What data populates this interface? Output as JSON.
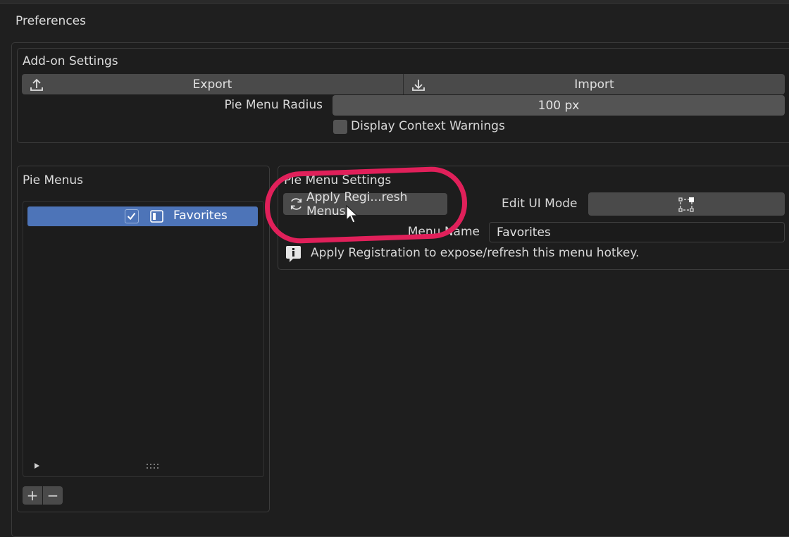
{
  "window": {
    "title": "Preferences"
  },
  "addon_settings": {
    "heading": "Add-on Settings",
    "export_label": "Export",
    "import_label": "Import",
    "radius_label": "Pie Menu Radius",
    "radius_value": "100 px",
    "context_warnings_label": "Display Context Warnings",
    "context_warnings_checked": false
  },
  "pie_menus": {
    "heading": "Pie Menus",
    "items": [
      {
        "label": "Favorites",
        "enabled": true,
        "selected": true
      }
    ],
    "add_label": "+",
    "remove_label": "−"
  },
  "pie_menu_settings": {
    "heading": "Pie Menu Settings",
    "apply_button_label": "Apply Regi...resh Menus",
    "edit_ui_mode_label": "Edit UI Mode",
    "menu_name_label": "Menu Name",
    "menu_name_value": "Favorites",
    "info_text": "Apply Registration to expose/refresh this menu hotkey."
  },
  "colors": {
    "accent": "#4d74b8",
    "highlight_ring": "#e0205a"
  }
}
